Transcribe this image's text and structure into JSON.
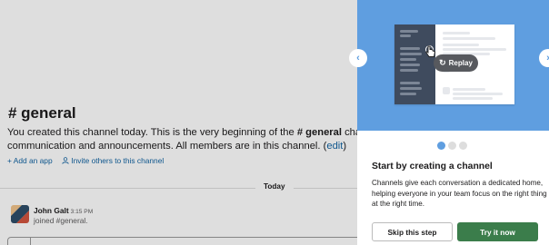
{
  "channel": {
    "name": "# general",
    "intro_prefix": "You created this channel today. This is the very beginning of the ",
    "intro_channel": "# general",
    "intro_suffix": " channel. Pur",
    "intro_line2": "communication and announcements. All members are in this channel. (",
    "edit_link": "edit",
    "intro_line2_end": ")",
    "add_app": "+ Add an app",
    "invite_others": "Invite others to this channel",
    "day_label": "Today"
  },
  "message": {
    "author": "John Galt",
    "time": "3:15 PM",
    "text": "joined #general."
  },
  "panel": {
    "prev_icon": "chevron-left-icon",
    "next_icon": "chevron-right-icon",
    "replay_label": "Replay",
    "title": "Start by creating a channel",
    "body": "Channels give each conversation a dedicated home, helping everyone in your team focus on the right thing at the right time.",
    "skip_label": "Skip this step",
    "try_label": "Try it now",
    "step_count": 3,
    "active_step": 1
  },
  "colors": {
    "hero_bg": "#5f9ee0",
    "primary_button": "#3b7d4b",
    "link": "#1264a3",
    "mock_sidebar": "#3f4b5e"
  }
}
